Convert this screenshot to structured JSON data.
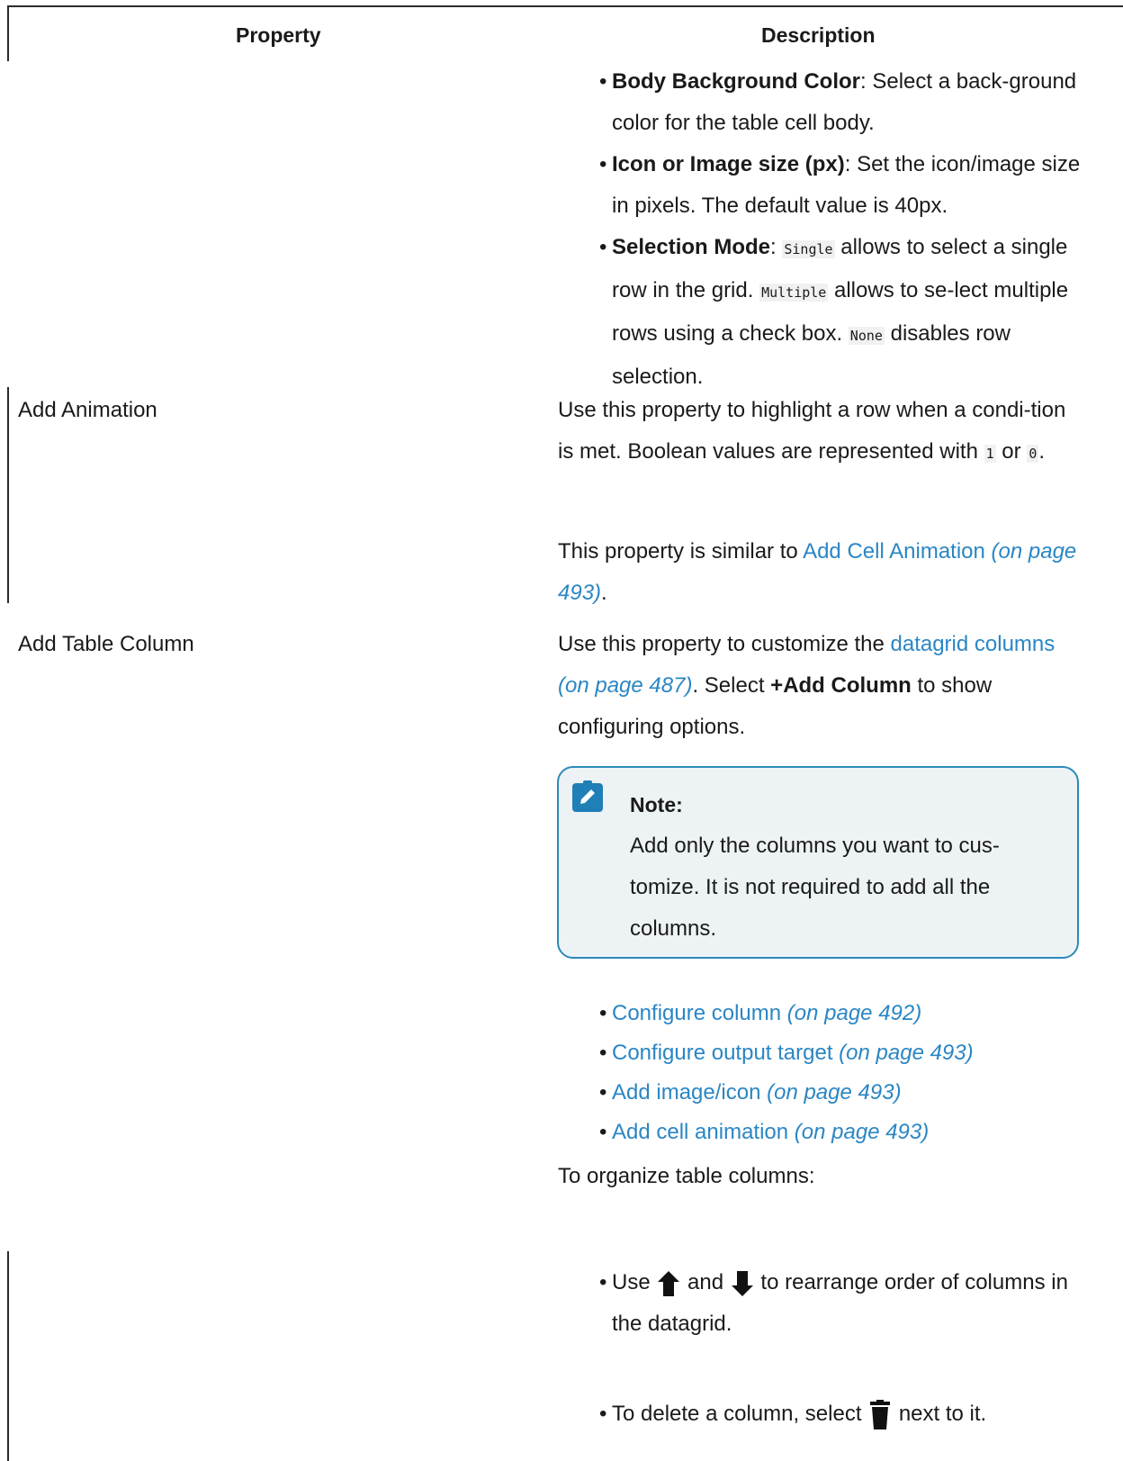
{
  "header": {
    "property": "Property",
    "description": "Description"
  },
  "top_bullets": [
    {
      "bold": "Body Background Color",
      "rest": ": Select a back-ground color for the table cell body."
    },
    {
      "bold": "Icon or Image size (px)",
      "rest": ": Set the icon/image size in pixels. The default value is 40px."
    },
    {
      "bold": "Selection Mode",
      "rest": ": "
    }
  ],
  "selection_mode": {
    "single_code": "Single",
    "single_text": " allows to select a single row in the grid. ",
    "multiple_code": "Multiple",
    "multiple_text": " allows to se-lect multiple rows using a check box. ",
    "none_code": "None",
    "none_text": " disables row selection."
  },
  "rows": {
    "add_animation": {
      "property": "Add Animation",
      "desc1_a": "Use this property to highlight a row when a condi-tion is met. Boolean values are represented with ",
      "code_1": "1",
      "desc1_b": " or ",
      "code_0": "0",
      "desc1_c": ".",
      "desc2_a": "This property is similar to ",
      "desc2_link": "Add Cell Animation",
      "desc2_page": " (on page 493)",
      "desc2_end": "."
    },
    "add_table_column": {
      "property": "Add Table Column",
      "desc_a": "Use this property to customize the ",
      "desc_link": "datagrid columns",
      "desc_page": " (on page 487)",
      "desc_b": ". Select ",
      "desc_bold": "+Add Column",
      "desc_c": " to show configuring options.",
      "note_title": "Note:",
      "note_body": "Add only the columns you want to cus-tomize. It is not required to add all the columns.",
      "links": [
        {
          "label": "Configure column",
          "page": " (on page 492)"
        },
        {
          "label": "Configure output target",
          "page": " (on page 493)"
        },
        {
          "label": "Add image/icon",
          "page": " (on page 493)"
        },
        {
          "label": "Add cell animation",
          "page": " (on page 493)"
        }
      ],
      "organize": "To organize table columns:",
      "use_a": "Use ",
      "use_and": " and ",
      "use_b": " to rearrange order of columns in the datagrid.",
      "delete_a": "To delete a column, select ",
      "delete_b": " next to it."
    }
  },
  "colors": {
    "link": "#2a86c4",
    "note_border": "#2c8ab8",
    "note_bg": "#edf2f5",
    "note_icon": "#1f7fb6"
  }
}
